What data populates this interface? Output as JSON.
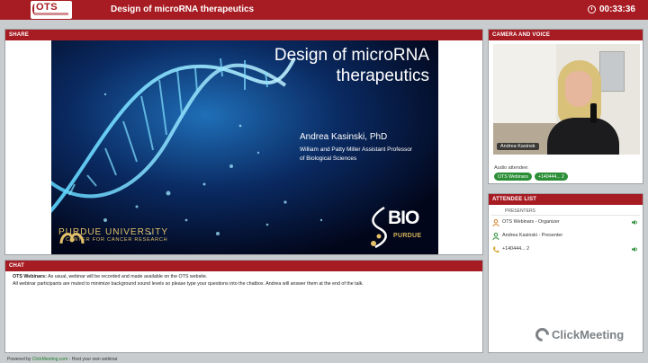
{
  "header": {
    "logo_text": "OTS",
    "title": "Design of microRNA therapeutics",
    "timer": "00:33:36"
  },
  "share": {
    "heading": "SHARE",
    "slide": {
      "title_line1": "Design of microRNA",
      "title_line2": "therapeutics",
      "presenter": "Andrea Kasinski, PhD",
      "affiliation_line1": "William and Patty Miller Assistant Professor",
      "affiliation_line2": "of Biological Sciences",
      "purdue_name": "PURDUE UNIVERSITY",
      "purdue_center": "CENTER FOR CANCER RESEARCH",
      "bio_logo": "BIO",
      "bio_sub": "PURDUE"
    }
  },
  "chat": {
    "heading": "CHAT",
    "sender": "OTS Webinars:",
    "message1": "As usual, webinar will be recorded and made available on the OTS website.",
    "message2": "All webinar participants are muted to minimize background sound levels so please type your questions into the chatbox. Andrea will answer them at the end of the talk."
  },
  "camera": {
    "heading": "CAMERA AND VOICE",
    "name_tag": "Andrea Kasinsk",
    "audio_label": "Audio attendee:",
    "audio_badges": [
      "OTS Webinars",
      "+140444... 2"
    ]
  },
  "attendees": {
    "heading": "ATTENDEE LIST",
    "subheading": "PRESENTERS",
    "rows": [
      {
        "label": "OTS Webinars - Organizer",
        "icon": "organizer-icon",
        "speaking": true
      },
      {
        "label": "Andrea Kasinski - Presenter",
        "icon": "presenter-icon",
        "speaking": false
      },
      {
        "label": "+140444... 2",
        "icon": "phone-icon",
        "speaking": true
      }
    ]
  },
  "branding": {
    "watermark": "ClickMeeting"
  },
  "footer": {
    "powered_by": "Powered by",
    "link": "ClickMeeting.com",
    "tagline": " - Host your own webinar"
  },
  "colors": {
    "brand_red": "#a71b22",
    "accent_green": "#2c8f38",
    "background": "#c9ccce"
  }
}
